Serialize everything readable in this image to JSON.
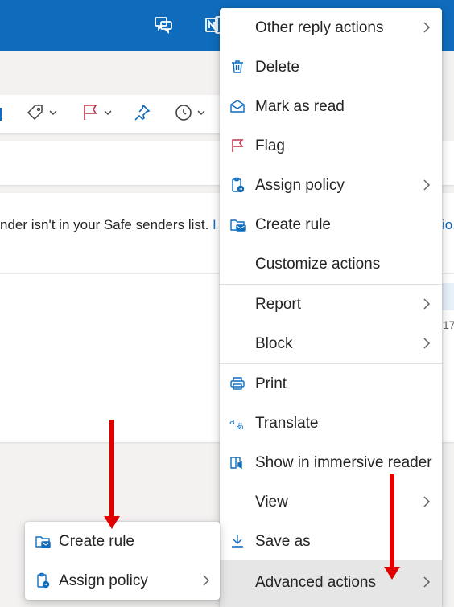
{
  "topbar": {
    "accent": "#0f6cbd",
    "icons": [
      "chat-icon",
      "onenote-icon"
    ]
  },
  "ribbon": {
    "icons": [
      "tag-icon",
      "flag-icon",
      "pin-icon",
      "clock-icon"
    ]
  },
  "message": {
    "safe_senders_text": "nder isn't in your Safe senders list.",
    "link_fragment": "I",
    "right_fragment": "io.",
    "date_fragment": "17"
  },
  "context_menu": {
    "items": [
      {
        "label": "Other reply actions",
        "icon": "",
        "submenu": true
      },
      {
        "label": "Delete",
        "icon": "trash-icon",
        "submenu": false
      },
      {
        "label": "Mark as read",
        "icon": "envelope-open-icon",
        "submenu": false
      },
      {
        "label": "Flag",
        "icon": "flag-icon",
        "submenu": false
      },
      {
        "label": "Assign policy",
        "icon": "policy-icon",
        "submenu": true
      },
      {
        "label": "Create rule",
        "icon": "folder-rule-icon",
        "submenu": false
      },
      {
        "label": "Customize actions",
        "icon": "",
        "submenu": false
      },
      {
        "label": "Report",
        "icon": "",
        "submenu": true
      },
      {
        "label": "Block",
        "icon": "",
        "submenu": true
      },
      {
        "label": "Print",
        "icon": "printer-icon",
        "submenu": false
      },
      {
        "label": "Translate",
        "icon": "translate-icon",
        "submenu": false
      },
      {
        "label": "Show in immersive reader",
        "icon": "immersive-reader-icon",
        "submenu": false
      },
      {
        "label": "View",
        "icon": "",
        "submenu": true
      },
      {
        "label": "Save as",
        "icon": "download-icon",
        "submenu": false
      },
      {
        "label": "Advanced actions",
        "icon": "",
        "submenu": true,
        "highlighted": true
      }
    ]
  },
  "submenu": {
    "items": [
      {
        "label": "Create rule",
        "icon": "folder-rule-icon",
        "submenu": false
      },
      {
        "label": "Assign policy",
        "icon": "policy-icon",
        "submenu": true
      }
    ]
  },
  "annotations": {
    "arrow_color": "#e00000"
  }
}
